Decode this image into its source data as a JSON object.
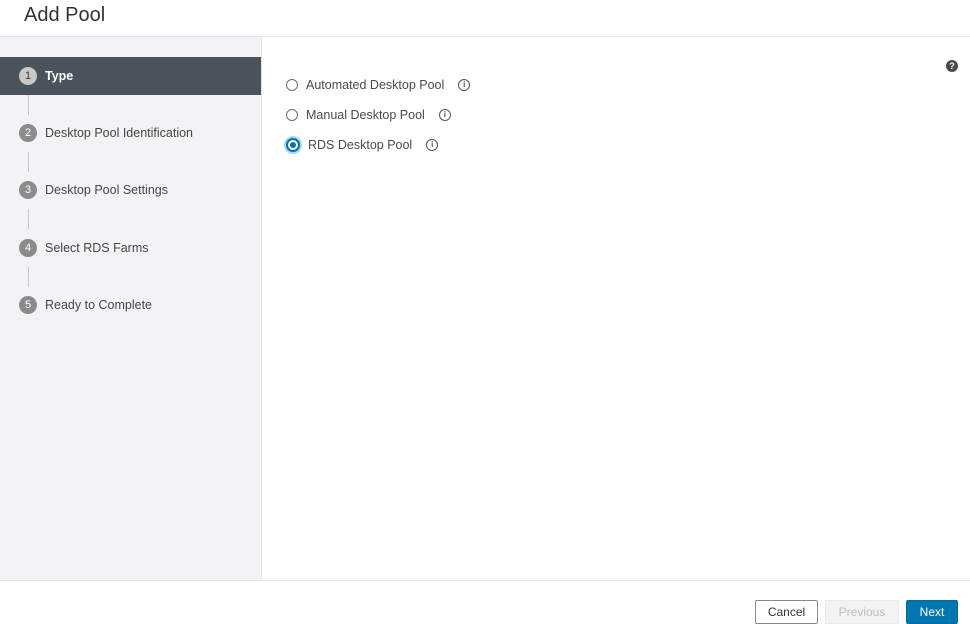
{
  "dialog": {
    "title": "Add Pool"
  },
  "steps": [
    {
      "number": "1",
      "label": "Type",
      "active": true
    },
    {
      "number": "2",
      "label": "Desktop Pool Identification",
      "active": false
    },
    {
      "number": "3",
      "label": "Desktop Pool Settings",
      "active": false
    },
    {
      "number": "4",
      "label": "Select RDS Farms",
      "active": false
    },
    {
      "number": "5",
      "label": "Ready to Complete",
      "active": false
    }
  ],
  "pool_types": {
    "selected": "RDS Desktop Pool",
    "options": [
      {
        "label": "Automated Desktop Pool",
        "checked": false
      },
      {
        "label": "Manual Desktop Pool",
        "checked": false
      },
      {
        "label": "RDS Desktop Pool",
        "checked": true
      }
    ]
  },
  "icons": {
    "help": "help-icon",
    "info": "info-icon",
    "help_glyph": "?",
    "info_glyph": "i"
  },
  "footer": {
    "cancel_label": "Cancel",
    "previous_label": "Previous",
    "next_label": "Next"
  },
  "colors": {
    "accent": "#0076b0",
    "active_step_bg": "#4a525b",
    "sidebar_bg": "#f3f3f5"
  }
}
